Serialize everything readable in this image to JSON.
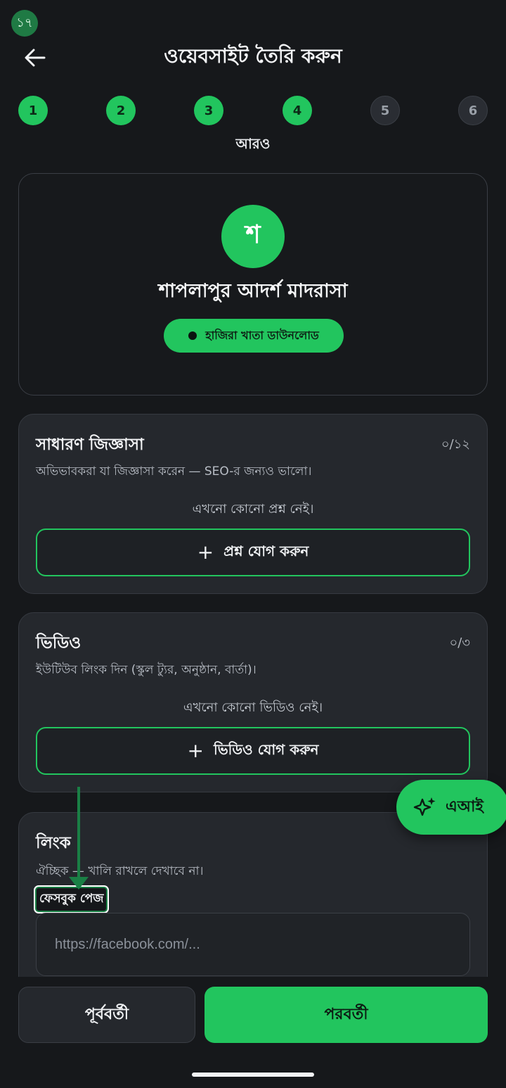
{
  "status": {
    "badge": "১৭"
  },
  "header": {
    "title": "ওয়েবসাইট তৈরি করুন",
    "back_icon": "arrow-left-icon"
  },
  "stepper": {
    "steps": [
      {
        "label": "1",
        "state": "done"
      },
      {
        "label": "2",
        "state": "done"
      },
      {
        "label": "3",
        "state": "done"
      },
      {
        "label": "4",
        "state": "done"
      },
      {
        "label": "5",
        "state": "todo"
      },
      {
        "label": "6",
        "state": "todo"
      }
    ],
    "current_caption": "আরও"
  },
  "profile": {
    "avatar_letter": "শ",
    "school_name": "শাপলাপুর আদর্শ মাদরাসা",
    "action_label": "হাজিরা খাতা ডাউনলোড"
  },
  "faq": {
    "title": "সাধারণ জিজ্ঞাসা",
    "count": "০/১২",
    "description": "অভিভাবকরা যা জিজ্ঞাসা করেন — SEO-র জন্যও ভালো।",
    "empty": "এখনো কোনো প্রশ্ন নেই।",
    "add_label": "প্রশ্ন যোগ করুন"
  },
  "video": {
    "title": "ভিডিও",
    "count": "০/৩",
    "description": "ইউটিউব লিংক দিন (স্কুল ট্যুর, অনুষ্ঠান, বার্তা)।",
    "empty": "এখনো কোনো ভিডিও নেই।",
    "add_label": "ভিডিও যোগ করুন"
  },
  "links": {
    "title": "লিংক",
    "description": "ঐচ্ছিক — খালি রাখলে দেখাবে না।",
    "facebook_label": "ফেসবুক পেজ",
    "facebook_placeholder": "https://facebook.com/..."
  },
  "ai_fab": {
    "label": "এআই",
    "icon": "sparkles-icon"
  },
  "footer": {
    "prev_label": "পূর্ববর্তী",
    "next_label": "পরবর্তী"
  },
  "colors": {
    "accent": "#22c55e",
    "background": "#16181b",
    "panel": "#25282d"
  }
}
